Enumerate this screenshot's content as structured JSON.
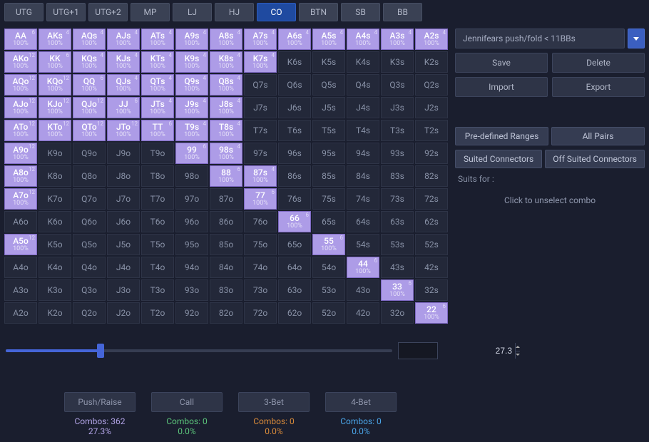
{
  "positions": [
    "UTG",
    "UTG+1",
    "UTG+2",
    "MP",
    "LJ",
    "HJ",
    "CO",
    "BTN",
    "SB",
    "BB"
  ],
  "active_position": "CO",
  "range_name": "Jennifears push/fold < 11BBs",
  "side_buttons": {
    "save": "Save",
    "delete": "Delete",
    "import": "Import",
    "export": "Export"
  },
  "quick_ranges": {
    "predefined": "Pre-defined Ranges",
    "allpairs": "All Pairs",
    "suited": "Suited Connectors",
    "offsuited": "Off Suited Connectors"
  },
  "suits_label": "Suits for :",
  "unselect_note": "Click to unselect combo",
  "slider_value": "27.3",
  "actions": [
    {
      "label": "Push/Raise",
      "combos": "Combos: 362",
      "pct": "27.3%",
      "color": "#b2a4e6"
    },
    {
      "label": "Call",
      "combos": "Combos: 0",
      "pct": "0.0%",
      "color": "#5bc37a"
    },
    {
      "label": "3-Bet",
      "combos": "Combos: 0",
      "pct": "0.0%",
      "color": "#d88a3a"
    },
    {
      "label": "4-Bet",
      "combos": "Combos: 0",
      "pct": "0.0%",
      "color": "#4aa5e8"
    }
  ],
  "grid": [
    [
      {
        "h": "AA",
        "s": 1,
        "c": 6
      },
      {
        "h": "AKs",
        "s": 1,
        "c": 4
      },
      {
        "h": "AQs",
        "s": 1,
        "c": 4
      },
      {
        "h": "AJs",
        "s": 1,
        "c": 4
      },
      {
        "h": "ATs",
        "s": 1,
        "c": 4
      },
      {
        "h": "A9s",
        "s": 1,
        "c": 4
      },
      {
        "h": "A8s",
        "s": 1,
        "c": 4
      },
      {
        "h": "A7s",
        "s": 1,
        "c": 4
      },
      {
        "h": "A6s",
        "s": 1,
        "c": 4
      },
      {
        "h": "A5s",
        "s": 1,
        "c": 4
      },
      {
        "h": "A4s",
        "s": 1,
        "c": 4
      },
      {
        "h": "A3s",
        "s": 1,
        "c": 4
      },
      {
        "h": "A2s",
        "s": 1,
        "c": 4
      }
    ],
    [
      {
        "h": "AKo",
        "s": 1,
        "c": 12
      },
      {
        "h": "KK",
        "s": 1,
        "c": 6
      },
      {
        "h": "KQs",
        "s": 1,
        "c": 4
      },
      {
        "h": "KJs",
        "s": 1,
        "c": 4
      },
      {
        "h": "KTs",
        "s": 1,
        "c": 4
      },
      {
        "h": "K9s",
        "s": 1,
        "c": 4
      },
      {
        "h": "K8s",
        "s": 1,
        "c": 4
      },
      {
        "h": "K7s",
        "s": 1,
        "c": 4
      },
      {
        "h": "K6s",
        "s": 0
      },
      {
        "h": "K5s",
        "s": 0
      },
      {
        "h": "K4s",
        "s": 0
      },
      {
        "h": "K3s",
        "s": 0
      },
      {
        "h": "K2s",
        "s": 0
      }
    ],
    [
      {
        "h": "AQo",
        "s": 1,
        "c": 12
      },
      {
        "h": "KQo",
        "s": 1,
        "c": 12
      },
      {
        "h": "QQ",
        "s": 1,
        "c": 6
      },
      {
        "h": "QJs",
        "s": 1,
        "c": 4
      },
      {
        "h": "QTs",
        "s": 1,
        "c": 4
      },
      {
        "h": "Q9s",
        "s": 1,
        "c": 4
      },
      {
        "h": "Q8s",
        "s": 1,
        "c": 4
      },
      {
        "h": "Q7s",
        "s": 0
      },
      {
        "h": "Q6s",
        "s": 0
      },
      {
        "h": "Q5s",
        "s": 0
      },
      {
        "h": "Q4s",
        "s": 0
      },
      {
        "h": "Q3s",
        "s": 0
      },
      {
        "h": "Q2s",
        "s": 0
      }
    ],
    [
      {
        "h": "AJo",
        "s": 1,
        "c": 12
      },
      {
        "h": "KJo",
        "s": 1,
        "c": 12
      },
      {
        "h": "QJo",
        "s": 1,
        "c": 12
      },
      {
        "h": "JJ",
        "s": 1,
        "c": 6
      },
      {
        "h": "JTs",
        "s": 1,
        "c": 4
      },
      {
        "h": "J9s",
        "s": 1,
        "c": 4
      },
      {
        "h": "J8s",
        "s": 1,
        "c": 4
      },
      {
        "h": "J7s",
        "s": 0
      },
      {
        "h": "J6s",
        "s": 0
      },
      {
        "h": "J5s",
        "s": 0
      },
      {
        "h": "J4s",
        "s": 0
      },
      {
        "h": "J3s",
        "s": 0
      },
      {
        "h": "J2s",
        "s": 0
      }
    ],
    [
      {
        "h": "ATo",
        "s": 1,
        "c": 12
      },
      {
        "h": "KTo",
        "s": 1,
        "c": 12
      },
      {
        "h": "QTo",
        "s": 1,
        "c": 12
      },
      {
        "h": "JTo",
        "s": 1,
        "c": 12
      },
      {
        "h": "TT",
        "s": 1,
        "c": 6
      },
      {
        "h": "T9s",
        "s": 1,
        "c": 4
      },
      {
        "h": "T8s",
        "s": 1,
        "c": 4
      },
      {
        "h": "T7s",
        "s": 0
      },
      {
        "h": "T6s",
        "s": 0
      },
      {
        "h": "T5s",
        "s": 0
      },
      {
        "h": "T4s",
        "s": 0
      },
      {
        "h": "T3s",
        "s": 0
      },
      {
        "h": "T2s",
        "s": 0
      }
    ],
    [
      {
        "h": "A9o",
        "s": 1,
        "c": 12
      },
      {
        "h": "K9o",
        "s": 0
      },
      {
        "h": "Q9o",
        "s": 0
      },
      {
        "h": "J9o",
        "s": 0
      },
      {
        "h": "T9o",
        "s": 0
      },
      {
        "h": "99",
        "s": 1,
        "c": 6
      },
      {
        "h": "98s",
        "s": 1,
        "c": 4
      },
      {
        "h": "97s",
        "s": 0
      },
      {
        "h": "96s",
        "s": 0
      },
      {
        "h": "95s",
        "s": 0
      },
      {
        "h": "94s",
        "s": 0
      },
      {
        "h": "93s",
        "s": 0
      },
      {
        "h": "92s",
        "s": 0
      }
    ],
    [
      {
        "h": "A8o",
        "s": 1,
        "c": 12
      },
      {
        "h": "K8o",
        "s": 0
      },
      {
        "h": "Q8o",
        "s": 0
      },
      {
        "h": "J8o",
        "s": 0
      },
      {
        "h": "T8o",
        "s": 0
      },
      {
        "h": "98o",
        "s": 0
      },
      {
        "h": "88",
        "s": 1,
        "c": 6
      },
      {
        "h": "87s",
        "s": 1,
        "c": 4
      },
      {
        "h": "86s",
        "s": 0
      },
      {
        "h": "85s",
        "s": 0
      },
      {
        "h": "84s",
        "s": 0
      },
      {
        "h": "83s",
        "s": 0
      },
      {
        "h": "82s",
        "s": 0
      }
    ],
    [
      {
        "h": "A7o",
        "s": 1,
        "c": 12
      },
      {
        "h": "K7o",
        "s": 0
      },
      {
        "h": "Q7o",
        "s": 0
      },
      {
        "h": "J7o",
        "s": 0
      },
      {
        "h": "T7o",
        "s": 0
      },
      {
        "h": "97o",
        "s": 0
      },
      {
        "h": "87o",
        "s": 0
      },
      {
        "h": "77",
        "s": 1,
        "c": 6
      },
      {
        "h": "76s",
        "s": 0
      },
      {
        "h": "75s",
        "s": 0
      },
      {
        "h": "74s",
        "s": 0
      },
      {
        "h": "73s",
        "s": 0
      },
      {
        "h": "72s",
        "s": 0
      }
    ],
    [
      {
        "h": "A6o",
        "s": 0
      },
      {
        "h": "K6o",
        "s": 0
      },
      {
        "h": "Q6o",
        "s": 0
      },
      {
        "h": "J6o",
        "s": 0
      },
      {
        "h": "T6o",
        "s": 0
      },
      {
        "h": "96o",
        "s": 0
      },
      {
        "h": "86o",
        "s": 0
      },
      {
        "h": "76o",
        "s": 0
      },
      {
        "h": "66",
        "s": 1,
        "c": 6
      },
      {
        "h": "65s",
        "s": 0
      },
      {
        "h": "64s",
        "s": 0
      },
      {
        "h": "63s",
        "s": 0
      },
      {
        "h": "62s",
        "s": 0
      }
    ],
    [
      {
        "h": "A5o",
        "s": 1,
        "c": 12
      },
      {
        "h": "K5o",
        "s": 0
      },
      {
        "h": "Q5o",
        "s": 0
      },
      {
        "h": "J5o",
        "s": 0
      },
      {
        "h": "T5o",
        "s": 0
      },
      {
        "h": "95o",
        "s": 0
      },
      {
        "h": "85o",
        "s": 0
      },
      {
        "h": "75o",
        "s": 0
      },
      {
        "h": "65o",
        "s": 0
      },
      {
        "h": "55",
        "s": 1,
        "c": 6
      },
      {
        "h": "54s",
        "s": 0
      },
      {
        "h": "53s",
        "s": 0
      },
      {
        "h": "52s",
        "s": 0
      }
    ],
    [
      {
        "h": "A4o",
        "s": 0
      },
      {
        "h": "K4o",
        "s": 0
      },
      {
        "h": "Q4o",
        "s": 0
      },
      {
        "h": "J4o",
        "s": 0
      },
      {
        "h": "T4o",
        "s": 0
      },
      {
        "h": "94o",
        "s": 0
      },
      {
        "h": "84o",
        "s": 0
      },
      {
        "h": "74o",
        "s": 0
      },
      {
        "h": "64o",
        "s": 0
      },
      {
        "h": "54o",
        "s": 0
      },
      {
        "h": "44",
        "s": 1,
        "c": 6
      },
      {
        "h": "43s",
        "s": 0
      },
      {
        "h": "42s",
        "s": 0
      }
    ],
    [
      {
        "h": "A3o",
        "s": 0
      },
      {
        "h": "K3o",
        "s": 0
      },
      {
        "h": "Q3o",
        "s": 0
      },
      {
        "h": "J3o",
        "s": 0
      },
      {
        "h": "T3o",
        "s": 0
      },
      {
        "h": "93o",
        "s": 0
      },
      {
        "h": "83o",
        "s": 0
      },
      {
        "h": "73o",
        "s": 0
      },
      {
        "h": "63o",
        "s": 0
      },
      {
        "h": "53o",
        "s": 0
      },
      {
        "h": "43o",
        "s": 0
      },
      {
        "h": "33",
        "s": 1,
        "c": 6
      },
      {
        "h": "32s",
        "s": 0
      }
    ],
    [
      {
        "h": "A2o",
        "s": 0
      },
      {
        "h": "K2o",
        "s": 0
      },
      {
        "h": "Q2o",
        "s": 0
      },
      {
        "h": "J2o",
        "s": 0
      },
      {
        "h": "T2o",
        "s": 0
      },
      {
        "h": "92o",
        "s": 0
      },
      {
        "h": "82o",
        "s": 0
      },
      {
        "h": "72o",
        "s": 0
      },
      {
        "h": "62o",
        "s": 0
      },
      {
        "h": "52o",
        "s": 0
      },
      {
        "h": "42o",
        "s": 0
      },
      {
        "h": "32o",
        "s": 0
      },
      {
        "h": "22",
        "s": 1,
        "c": 6
      }
    ]
  ],
  "pct_label": "100%"
}
